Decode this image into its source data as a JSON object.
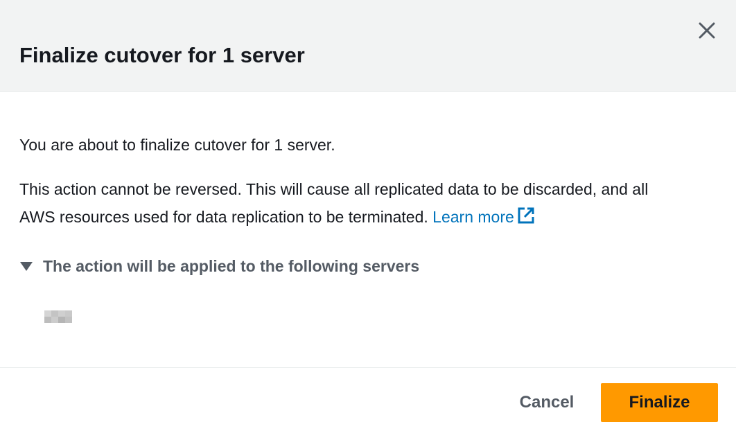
{
  "modal": {
    "title": "Finalize cutover for 1 server",
    "close_icon": "close-icon"
  },
  "body": {
    "intro": "You are about to finalize cutover for 1 server.",
    "warning_line1": "This action cannot be reversed. This will cause all replicated data to be discarded, and all",
    "warning_line2": "AWS resources used for data replication to be terminated.",
    "learn_more": "Learn more",
    "learn_more_icon": "external-link-icon",
    "expander_label": "The action will be applied to the following servers",
    "expander_icon": "caret-down-icon",
    "expanded": true,
    "servers_redacted": true
  },
  "footer": {
    "cancel_label": "Cancel",
    "finalize_label": "Finalize"
  },
  "colors": {
    "header_bg": "#f2f3f3",
    "primary_button": "#ff9900",
    "link": "#0073bb",
    "secondary_text": "#545b64"
  }
}
